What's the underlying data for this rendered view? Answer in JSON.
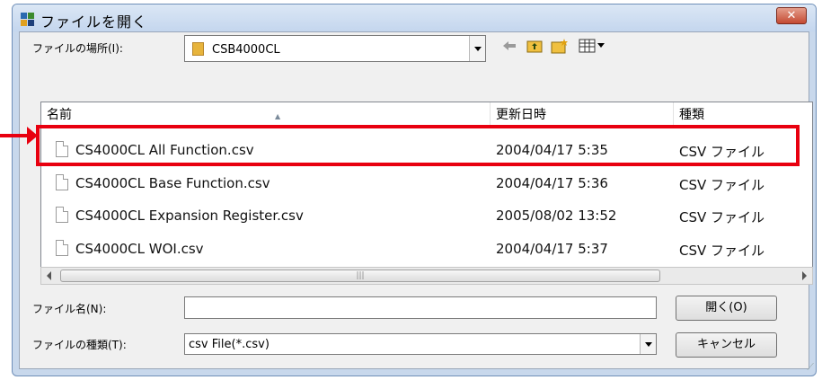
{
  "dialog": {
    "title": "ファイルを開く",
    "close_label": "✕"
  },
  "location": {
    "label": "ファイルの場所(I):",
    "folder": "CSB4000CL"
  },
  "toolbar": {
    "icons": [
      "back-arrow-icon",
      "up-folder-icon",
      "new-folder-icon",
      "view-menu-icon"
    ]
  },
  "file_list": {
    "columns": [
      "名前",
      "更新日時",
      "種類"
    ],
    "rows": [
      {
        "name": "CS4000CL All Function.csv",
        "date": "2004/04/17 5:35",
        "type": "CSV ファイル",
        "highlighted": true
      },
      {
        "name": "CS4000CL Base Function.csv",
        "date": "2004/04/17 5:36",
        "type": "CSV ファイル"
      },
      {
        "name": "CS4000CL Expansion Register.csv",
        "date": "2005/08/02 13:52",
        "type": "CSV ファイル"
      },
      {
        "name": "CS4000CL WOI.csv",
        "date": "2004/04/17 5:37",
        "type": "CSV ファイル"
      }
    ]
  },
  "filename": {
    "label": "ファイル名(N):",
    "value": ""
  },
  "filetype": {
    "label": "ファイルの種類(T):",
    "value": "csv File(*.csv)"
  },
  "buttons": {
    "open": "開く(O)",
    "cancel": "キャンセル"
  },
  "colors": {
    "highlight": "#e8000f",
    "titlebar": "#c8d8ec"
  }
}
